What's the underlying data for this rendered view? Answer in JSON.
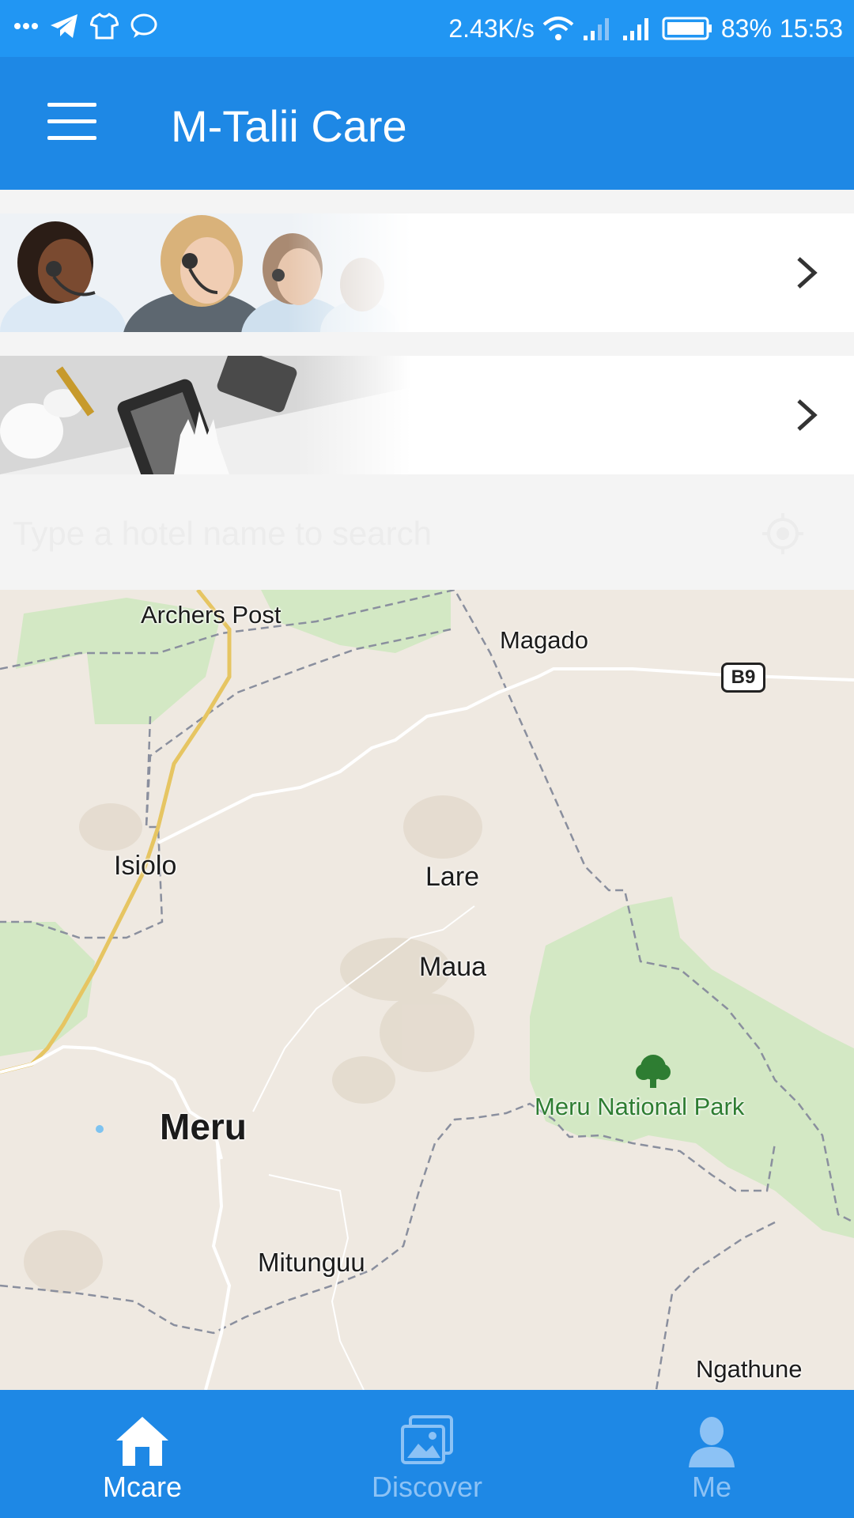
{
  "status_bar": {
    "speed": "2.43K/s",
    "battery": "83%",
    "time": "15:53"
  },
  "app_bar": {
    "title": "M-Talii Care"
  },
  "search": {
    "placeholder": "Type a hotel name to search"
  },
  "map": {
    "labels": {
      "archers_post": "Archers Post",
      "magado": "Magado",
      "isiolo": "Isiolo",
      "lare": "Lare",
      "maua": "Maua",
      "meru": "Meru",
      "meru_national_park": "Meru National Park",
      "mitunguu": "Mitunguu",
      "ngathune": "Ngathune"
    },
    "road_shield": "B9"
  },
  "bottom_nav": {
    "mcare": "Mcare",
    "discover": "Discover",
    "me": "Me"
  },
  "colors": {
    "status_bar": "#2196f3",
    "app_bar": "#1e88e5",
    "nav_inactive": "#8cc2f5",
    "park_green": "#d3e8c4"
  }
}
